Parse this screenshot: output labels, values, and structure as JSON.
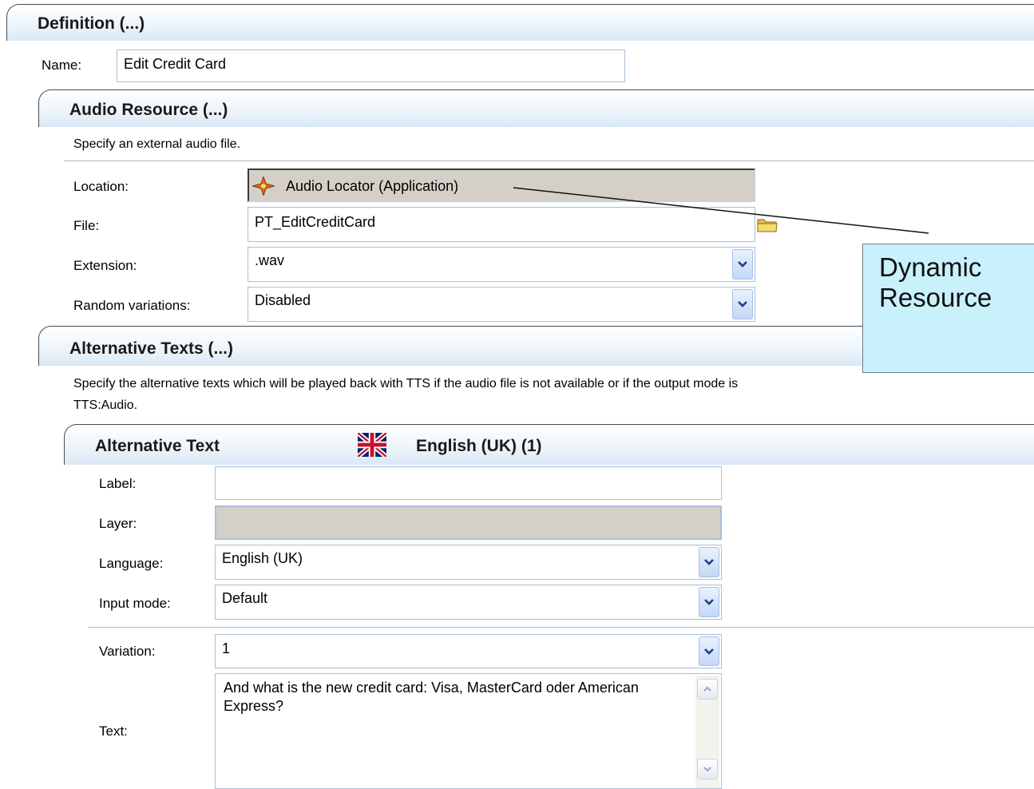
{
  "definition": {
    "title": "Definition (...)",
    "name_label": "Name:",
    "name_value": "Edit Credit Card"
  },
  "audio_resource": {
    "title": "Audio Resource (...)",
    "description": "Specify an external audio file.",
    "location_label": "Location:",
    "location_value": "Audio Locator (Application)",
    "file_label": "File:",
    "file_value": "PT_EditCreditCard",
    "extension_label": "Extension:",
    "extension_value": ".wav",
    "random_label": "Random variations:",
    "random_value": "Disabled"
  },
  "alternative_texts": {
    "title": "Alternative Texts (...)",
    "description_line1": "Specify the alternative texts which will be played back with TTS if the audio file is not available or if the output mode is",
    "description_line2": "TTS:Audio."
  },
  "alternative_text": {
    "title": "Alternative Text",
    "language_header": "English (UK) (1)",
    "label_label": "Label:",
    "label_value": "",
    "layer_label": "Layer:",
    "layer_value": "",
    "language_label": "Language:",
    "language_value": "English (UK)",
    "input_mode_label": "Input mode:",
    "input_mode_value": "Default",
    "variation_label": "Variation:",
    "variation_value": "1",
    "text_label": "Text:",
    "text_value": "And what is the new credit card: Visa, MasterCard oder American Express?"
  },
  "callout": {
    "line1": "Dynamic",
    "line2": "Resource"
  },
  "icons": {
    "locator": "audio-locator-icon",
    "folder": "folder-icon",
    "flag": "uk-flag-icon",
    "dropdown": "chevron-down-icon"
  },
  "colors": {
    "header_gradient_end": "#d9e8f5",
    "field_border": "#a9bfd6",
    "readonly_bg": "#d4d0c8",
    "callout_bg": "#c9f1fb"
  }
}
